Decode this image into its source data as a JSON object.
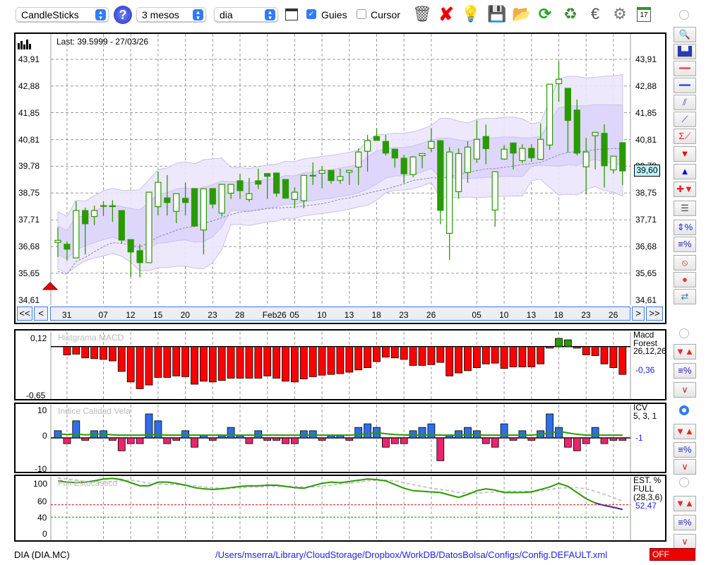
{
  "toolbar": {
    "chart_type": "CandleSticks",
    "period": "3 mesos",
    "interval": "dia",
    "guides_label": "Guies",
    "guides_checked": true,
    "cursor_label": "Cursor",
    "cursor_checked": false,
    "icons": [
      "help-icon",
      "chart-window-icon",
      "trash-icon",
      "delete-icon",
      "lamp-icon",
      "save-icon",
      "folder-icon",
      "refresh-icon",
      "recycle-money-icon",
      "euro-icon",
      "gear-icon",
      "calendar-icon"
    ],
    "calendar_day": "17"
  },
  "main_chart": {
    "last_label": "Last: 39.5999 - 27/03/26",
    "price_tag": "39,60",
    "y_ticks": [
      "43,91",
      "42,88",
      "41,85",
      "40,81",
      "39,78",
      "38,75",
      "37,71",
      "36,68",
      "35,65",
      "34,61"
    ],
    "y_tick_values": [
      43.91,
      42.88,
      41.85,
      40.81,
      39.78,
      38.75,
      37.71,
      36.68,
      35.65,
      34.61
    ],
    "nav": {
      "first": "<<",
      "prev": "<",
      "next": ">",
      "last": ">>"
    },
    "date_labels": [
      {
        "t": "31",
        "i": 1
      },
      {
        "t": "07",
        "i": 5
      },
      {
        "t": "12",
        "i": 8
      },
      {
        "t": "15",
        "i": 11
      },
      {
        "t": "20",
        "i": 14
      },
      {
        "t": "23",
        "i": 17
      },
      {
        "t": "28",
        "i": 20
      },
      {
        "t": "Feb26",
        "i": 23
      },
      {
        "t": "05",
        "i": 26
      },
      {
        "t": "10",
        "i": 29
      },
      {
        "t": "13",
        "i": 32
      },
      {
        "t": "18",
        "i": 35
      },
      {
        "t": "23",
        "i": 38
      },
      {
        "t": "26",
        "i": 41
      },
      {
        "t": "05",
        "i": 46
      },
      {
        "t": "10",
        "i": 49
      },
      {
        "t": "13",
        "i": 52
      },
      {
        "t": "18",
        "i": 55
      },
      {
        "t": "23",
        "i": 58
      },
      {
        "t": "26",
        "i": 61
      }
    ]
  },
  "chart_data": [
    {
      "type": "candlestick",
      "title": "CandleSticks",
      "ylim": [
        34.61,
        43.91
      ],
      "ohlc": [
        [
          36.84,
          37.42,
          36.28,
          36.92
        ],
        [
          36.77,
          36.87,
          36.14,
          36.58
        ],
        [
          36.24,
          38.43,
          36.24,
          38.07
        ],
        [
          38.07,
          38.18,
          36.38,
          37.56
        ],
        [
          37.84,
          38.26,
          37.51,
          38.07
        ],
        [
          38.26,
          38.43,
          37.86,
          38.26
        ],
        [
          38.25,
          38.47,
          37.63,
          38.25
        ],
        [
          38.07,
          38.07,
          36.8,
          36.93
        ],
        [
          36.95,
          36.95,
          35.5,
          36.47
        ],
        [
          36.52,
          36.77,
          35.49,
          36.06
        ],
        [
          36.06,
          38.79,
          36.04,
          38.78
        ],
        [
          38.22,
          39.58,
          37.88,
          39.16
        ],
        [
          38.56,
          39.44,
          37.88,
          38.38
        ],
        [
          38.04,
          38.72,
          37.58,
          38.72
        ],
        [
          38.54,
          39.16,
          37.88,
          38.38
        ],
        [
          38.92,
          38.92,
          37.45,
          37.47
        ],
        [
          37.32,
          38.92,
          36.38,
          38.91
        ],
        [
          38.92,
          38.92,
          38.16,
          38.32
        ],
        [
          37.97,
          39.08,
          37.84,
          39.08
        ],
        [
          38.74,
          39.08,
          38.52,
          39.08
        ],
        [
          39.22,
          39.49,
          38.52,
          38.84
        ],
        [
          38.5,
          39.33,
          38.41,
          38.72
        ],
        [
          39.22,
          39.69,
          38.9,
          39.09
        ],
        [
          39.5,
          39.5,
          38.52,
          39.39
        ],
        [
          39.52,
          39.52,
          38.6,
          38.74
        ],
        [
          39.27,
          39.27,
          38.52,
          38.55
        ],
        [
          38.5,
          38.97,
          38.16,
          38.78
        ],
        [
          38.45,
          39.43,
          38.16,
          39.43
        ],
        [
          39.43,
          39.93,
          39.06,
          39.43
        ],
        [
          39.51,
          39.79,
          38.93,
          39.62
        ],
        [
          39.62,
          39.62,
          39.11,
          39.23
        ],
        [
          39.24,
          39.68,
          39.11,
          39.38
        ],
        [
          39.55,
          39.62,
          39.06,
          39.62
        ],
        [
          39.75,
          40.47,
          39.06,
          40.33
        ],
        [
          40.36,
          40.99,
          39.57,
          40.77
        ],
        [
          40.93,
          41.25,
          40.78,
          40.78
        ],
        [
          40.74,
          40.99,
          40.2,
          40.29
        ],
        [
          40.44,
          40.44,
          39.72,
          40.1
        ],
        [
          40.09,
          40.22,
          39.13,
          39.49
        ],
        [
          39.46,
          40.17,
          39.36,
          40.14
        ],
        [
          40.19,
          40.27,
          39.7,
          40.27
        ],
        [
          40.47,
          41.25,
          40.32,
          40.74
        ],
        [
          40.77,
          40.77,
          37.54,
          38.08
        ],
        [
          37.19,
          40.52,
          36.16,
          40.33
        ],
        [
          38.8,
          40.47,
          38.52,
          40.27
        ],
        [
          39.54,
          40.75,
          39.14,
          40.52
        ],
        [
          40.06,
          41.55,
          39.91,
          40.82
        ],
        [
          40.93,
          41.39,
          39.86,
          40.46
        ],
        [
          38.09,
          39.57,
          37.45,
          39.57
        ],
        [
          40.06,
          40.6,
          40.02,
          40.44
        ],
        [
          40.68,
          40.68,
          39.66,
          40.29
        ],
        [
          40.0,
          40.63,
          39.91,
          40.47
        ],
        [
          40.47,
          40.63,
          39.95,
          40.11
        ],
        [
          40.05,
          41.43,
          40.02,
          40.82
        ],
        [
          40.6,
          42.95,
          40.42,
          42.95
        ],
        [
          42.97,
          43.84,
          42.27,
          43.14
        ],
        [
          42.79,
          42.79,
          40.31,
          41.55
        ],
        [
          41.95,
          42.36,
          40.2,
          40.29
        ],
        [
          39.76,
          40.88,
          38.7,
          40.33
        ],
        [
          40.96,
          41.09,
          39.66,
          41.09
        ],
        [
          41.05,
          41.4,
          38.96,
          39.8
        ],
        [
          39.64,
          40.17,
          39.5,
          40.17
        ],
        [
          40.69,
          40.69,
          39.06,
          39.6
        ]
      ]
    },
    {
      "type": "bar",
      "title": "Histgrama MACD",
      "ylim": [
        -0.65,
        0.12
      ],
      "tick_labels": [
        "0,12",
        "-0,65"
      ],
      "legend": [
        "Macd",
        "Forest",
        "26,12,26"
      ],
      "last_value": "-0,36",
      "start_index": 1,
      "values": [
        -0.11,
        -0.1,
        -0.15,
        -0.16,
        -0.17,
        -0.19,
        -0.33,
        -0.47,
        -0.56,
        -0.51,
        -0.41,
        -0.41,
        -0.39,
        -0.4,
        -0.5,
        -0.46,
        -0.47,
        -0.45,
        -0.42,
        -0.42,
        -0.42,
        -0.42,
        -0.39,
        -0.42,
        -0.46,
        -0.47,
        -0.43,
        -0.4,
        -0.38,
        -0.37,
        -0.36,
        -0.34,
        -0.31,
        -0.28,
        -0.2,
        -0.14,
        -0.15,
        -0.17,
        -0.25,
        -0.25,
        -0.24,
        -0.21,
        -0.39,
        -0.35,
        -0.32,
        -0.28,
        -0.23,
        -0.22,
        -0.29,
        -0.27,
        -0.27,
        -0.27,
        -0.23,
        -0.02,
        0.11,
        0.09,
        -0.02,
        -0.11,
        -0.12,
        -0.23,
        -0.28,
        -0.37
      ]
    },
    {
      "type": "bar",
      "title": "Indice Calidad Vela",
      "ylim": [
        -10,
        10
      ],
      "tick_labels": [
        "10",
        "0",
        "-10"
      ],
      "legend": [
        "ICV",
        "5, 3, 1"
      ],
      "last_value": "-1",
      "values": [
        2.6,
        -2.1,
        6.2,
        -0.9,
        2.6,
        2.6,
        -0.9,
        -4.7,
        -2.1,
        -2.1,
        8.7,
        6.2,
        -2.1,
        -0.9,
        2.6,
        -3.4,
        1,
        -0.9,
        1,
        3.8,
        1,
        -2.1,
        2.6,
        -0.9,
        -0.9,
        -2.1,
        -2.1,
        2.6,
        2.6,
        -0.9,
        1,
        1,
        -0.9,
        3.8,
        5.1,
        3.8,
        -3.4,
        -2.1,
        -2.1,
        2.6,
        3.8,
        5.1,
        -8.3,
        1,
        2.6,
        3.8,
        2.6,
        -2.1,
        -3.4,
        5.1,
        -0.9,
        2.6,
        -0.9,
        2.6,
        8.7,
        3.8,
        -3.4,
        -4.7,
        -2.1,
        3.8,
        -2.1,
        -0.9,
        -0.9
      ],
      "signal": [
        1.5,
        1.2,
        1.4,
        1.1,
        1.3,
        1.4,
        1.1,
        1,
        1,
        1,
        1.1,
        1.2,
        1,
        1,
        1,
        1,
        1,
        1,
        1,
        1,
        1,
        1,
        1,
        1,
        1,
        1,
        1,
        1,
        1,
        1,
        1,
        1,
        1,
        1.2,
        1.5,
        1.9,
        1.5,
        1.2,
        1.1,
        1,
        1,
        1.1,
        1,
        1,
        1,
        1.1,
        1.1,
        1,
        1,
        1,
        1,
        1,
        1,
        1.3,
        1.8,
        2.4,
        1.8,
        1.3,
        1,
        1,
        1,
        1,
        1
      ]
    },
    {
      "type": "line",
      "title": "Full Estocastico",
      "ylim": [
        0,
        105
      ],
      "tick_labels": [
        "100",
        "60",
        "40",
        "0"
      ],
      "tick_values": [
        100,
        60,
        40,
        0
      ],
      "reference_lines": [
        {
          "value": 60,
          "color": "#e00000"
        },
        {
          "value": 40,
          "color": "#2a8a00"
        }
      ],
      "legend": [
        "EST. %",
        "FULL",
        "(28,3,6)"
      ],
      "last_value": "52,47",
      "k": [
        99,
        97,
        96,
        97,
        99,
        102,
        103,
        101,
        96,
        91,
        91,
        97,
        97,
        95,
        92,
        88,
        86,
        85,
        86,
        88,
        90,
        91,
        91,
        92,
        92,
        90,
        88,
        87,
        91,
        95,
        97,
        96,
        98,
        100,
        102,
        101,
        99,
        93,
        87,
        83,
        82,
        81,
        80,
        76,
        72,
        77,
        83,
        86,
        84,
        80,
        80,
        80,
        81,
        85,
        89,
        95,
        90,
        80,
        70,
        63,
        59,
        56,
        52.47
      ],
      "k_highlight_from": 59,
      "d": [
        104,
        102,
        100,
        98,
        97,
        97,
        98,
        99,
        100,
        98,
        95,
        94,
        93,
        93,
        92,
        91,
        89,
        88,
        87,
        87,
        88,
        89,
        89,
        90,
        90,
        90,
        90,
        89,
        89,
        90,
        92,
        94,
        95,
        97,
        99,
        100,
        100,
        99,
        96,
        93,
        90,
        87,
        85,
        83,
        80,
        79,
        79,
        80,
        81,
        82,
        82,
        82,
        82,
        83,
        85,
        87,
        88,
        88,
        86,
        82,
        77,
        72,
        66
      ]
    }
  ],
  "colors": {
    "candle": "#2a9a00",
    "macd_neg": "#ff0000",
    "macd_pos": "#2a9a00",
    "icv_pos": "#2f6ee8",
    "icv_neg": "#e8246c",
    "stoch_k": "#2a9a00",
    "stoch_k_hl": "#3a2a9a",
    "stoch_d": "#c8c8c8",
    "band_outer": "#ebe6fb",
    "band_inner": "#ddd5fb",
    "link": "#2020ff",
    "off": "#ee0000"
  },
  "status": {
    "symbol": "DIA (DIA.MC)",
    "config_path": "/Users/mserra/Library/CloudStorage/Dropbox/WorkDB/DatosBolsa/Configs/Config.DEFAULT.xml",
    "off_label": "OFF"
  },
  "side_buttons": [
    "zoom-icon",
    "chart-thumbnail-icon",
    "red-line-icon",
    "blue-line-icon",
    "channel-icon",
    "trendline-icon",
    "sigma-trendline-icon",
    "arrow-down-icon",
    "arrow-up-icon",
    "add-signal-icon",
    "dashed-lines-icon",
    "percent-range-icon",
    "percent-lines-icon",
    "no-entry-icon",
    "record-icon",
    "sync-icon"
  ]
}
